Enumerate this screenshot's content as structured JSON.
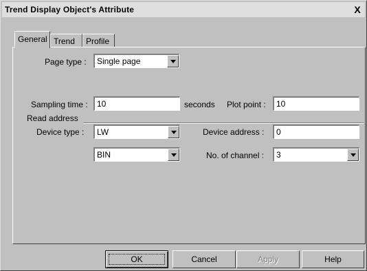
{
  "window": {
    "title": "Trend Display Object's Attribute",
    "close_label": "X"
  },
  "tabs": [
    {
      "label": "General"
    },
    {
      "label": "Trend"
    },
    {
      "label": "Profile"
    }
  ],
  "general": {
    "page_type": {
      "label": "Page type :",
      "value": "Single page"
    },
    "sampling_time": {
      "label": "Sampling time :",
      "value": "10",
      "unit": "seconds"
    },
    "plot_point": {
      "label": "Plot point :",
      "value": "10"
    },
    "read_address": {
      "label": "Read address"
    },
    "device_type": {
      "label": "Device type :",
      "value": "LW"
    },
    "device_address": {
      "label": "Device address :",
      "value": "0"
    },
    "format": {
      "value": "BIN"
    },
    "no_of_channel": {
      "label": "No. of channel :",
      "value": "3"
    }
  },
  "buttons": {
    "ok": "OK",
    "cancel": "Cancel",
    "apply": "Apply",
    "help": "Help"
  }
}
